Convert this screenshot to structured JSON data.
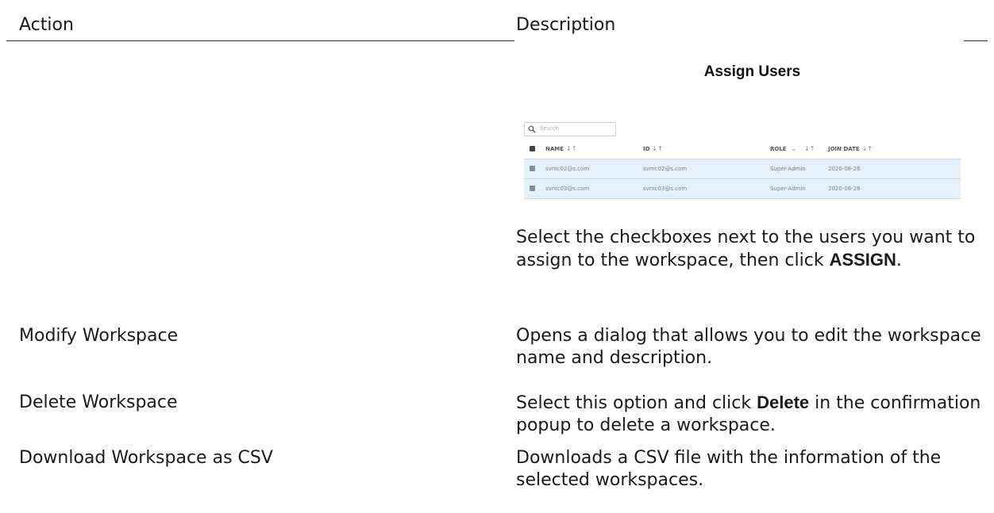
{
  "table": {
    "header_action": "Action",
    "header_description": "Description"
  },
  "assign_screenshot": {
    "title": "Assign Users",
    "search_placeholder": "Search",
    "columns": {
      "name": "NAME",
      "id": "ID",
      "role": "ROLE",
      "role_dropdown": "⌄",
      "join_date": "JOIN DATE",
      "sort_arrows": "↓↑"
    },
    "rows": [
      {
        "name": "svmc02@s.com",
        "id": "svmc02@s.com",
        "role": "Super-Admin",
        "join_date": "2020-08-26",
        "checked": true
      },
      {
        "name": "svmc03@s.com",
        "id": "svmc03@s.com",
        "role": "Super-Admin",
        "join_date": "2020-08-26",
        "checked": true
      }
    ]
  },
  "assign_description": {
    "text": "Select the checkboxes next to the users you want to assign to the workspace, then click ",
    "bold": "ASSIGN",
    "end": "."
  },
  "modify": {
    "action": "Modify Workspace",
    "description": "Opens a dialog that allows you to edit the workspace name and description."
  },
  "delete": {
    "action": "Delete Workspace",
    "description_start": "Select this option and click ",
    "bold": "Delete",
    "description_end": " in the confirmation popup to delete a workspace."
  },
  "download": {
    "action": "Download Workspace as CSV",
    "description": "Downloads a CSV file with the information of the selected workspaces."
  },
  "colors": {
    "selected_row_bg": "#e4f1fb",
    "text": "#1a1a1a"
  }
}
